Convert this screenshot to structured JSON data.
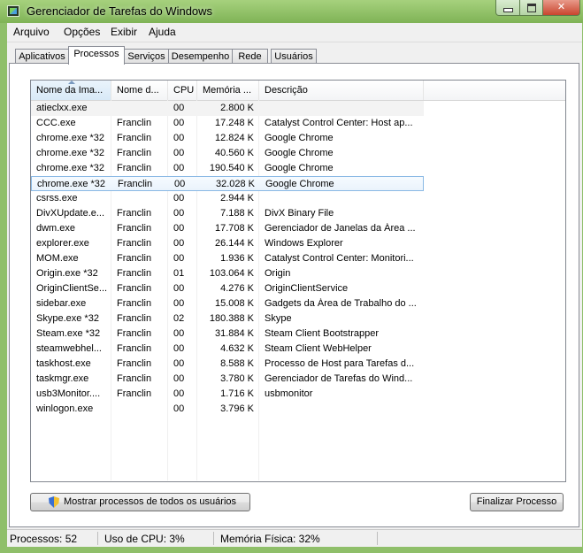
{
  "window": {
    "title": "Gerenciador de Tarefas do Windows"
  },
  "menu": [
    "Arquivo",
    "Opções",
    "Exibir",
    "Ajuda"
  ],
  "tabs": [
    "Aplicativos",
    "Processos",
    "Serviços",
    "Desempenho",
    "Rede",
    "Usuários"
  ],
  "active_tab": "Processos",
  "columns": [
    "Nome da Ima...",
    "Nome d...",
    "CPU",
    "Memória ...",
    "Descrição"
  ],
  "rows": [
    {
      "image": "atieclxx.exe",
      "user": "",
      "cpu": "00",
      "mem": "2.800 K",
      "desc": ""
    },
    {
      "image": "CCC.exe",
      "user": "Franclin",
      "cpu": "00",
      "mem": "17.248 K",
      "desc": "Catalyst Control Center: Host ap..."
    },
    {
      "image": "chrome.exe *32",
      "user": "Franclin",
      "cpu": "00",
      "mem": "12.824 K",
      "desc": "Google Chrome"
    },
    {
      "image": "chrome.exe *32",
      "user": "Franclin",
      "cpu": "00",
      "mem": "40.560 K",
      "desc": "Google Chrome"
    },
    {
      "image": "chrome.exe *32",
      "user": "Franclin",
      "cpu": "00",
      "mem": "190.540 K",
      "desc": "Google Chrome"
    },
    {
      "image": "chrome.exe *32",
      "user": "Franclin",
      "cpu": "00",
      "mem": "32.028 K",
      "desc": "Google Chrome"
    },
    {
      "image": "csrss.exe",
      "user": "",
      "cpu": "00",
      "mem": "2.944 K",
      "desc": ""
    },
    {
      "image": "DivXUpdate.e...",
      "user": "Franclin",
      "cpu": "00",
      "mem": "7.188 K",
      "desc": "DivX Binary File"
    },
    {
      "image": "dwm.exe",
      "user": "Franclin",
      "cpu": "00",
      "mem": "17.708 K",
      "desc": "Gerenciador de Janelas da Área ..."
    },
    {
      "image": "explorer.exe",
      "user": "Franclin",
      "cpu": "00",
      "mem": "26.144 K",
      "desc": "Windows Explorer"
    },
    {
      "image": "MOM.exe",
      "user": "Franclin",
      "cpu": "00",
      "mem": "1.936 K",
      "desc": "Catalyst Control Center: Monitori..."
    },
    {
      "image": "Origin.exe *32",
      "user": "Franclin",
      "cpu": "01",
      "mem": "103.064 K",
      "desc": "Origin"
    },
    {
      "image": "OriginClientSe...",
      "user": "Franclin",
      "cpu": "00",
      "mem": "4.276 K",
      "desc": "OriginClientService"
    },
    {
      "image": "sidebar.exe",
      "user": "Franclin",
      "cpu": "00",
      "mem": "15.008 K",
      "desc": "Gadgets da Área de Trabalho do ..."
    },
    {
      "image": "Skype.exe *32",
      "user": "Franclin",
      "cpu": "02",
      "mem": "180.388 K",
      "desc": "Skype"
    },
    {
      "image": "Steam.exe *32",
      "user": "Franclin",
      "cpu": "00",
      "mem": "31.884 K",
      "desc": "Steam Client Bootstrapper"
    },
    {
      "image": "steamwebhel...",
      "user": "Franclin",
      "cpu": "00",
      "mem": "4.632 K",
      "desc": "Steam Client WebHelper"
    },
    {
      "image": "taskhost.exe",
      "user": "Franclin",
      "cpu": "00",
      "mem": "8.588 K",
      "desc": "Processo de Host para Tarefas d..."
    },
    {
      "image": "taskmgr.exe",
      "user": "Franclin",
      "cpu": "00",
      "mem": "3.780 K",
      "desc": "Gerenciador de Tarefas do Wind..."
    },
    {
      "image": "usb3Monitor....",
      "user": "Franclin",
      "cpu": "00",
      "mem": "1.716 K",
      "desc": "usbmonitor"
    },
    {
      "image": "winlogon.exe",
      "user": "",
      "cpu": "00",
      "mem": "3.796 K",
      "desc": ""
    }
  ],
  "buttons": {
    "show_all": "Mostrar processos de todos os usuários",
    "end_process": "Finalizar Processo"
  },
  "status": {
    "processes": "Processos: 52",
    "cpu": "Uso de CPU: 3%",
    "memory": "Memória Física: 32%"
  }
}
